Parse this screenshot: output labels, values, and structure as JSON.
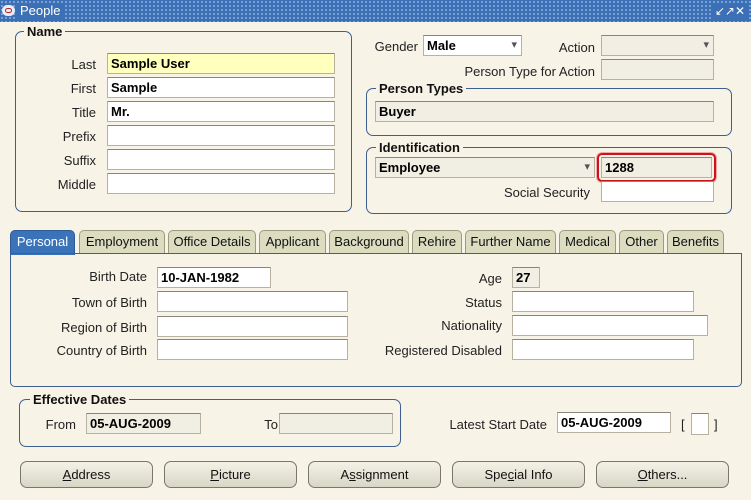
{
  "window": {
    "title": "People",
    "controls": "↙↗✕"
  },
  "name": {
    "legend": "Name",
    "last_label": "Last",
    "last_value": "Sample User",
    "first_label": "First",
    "first_value": "Sample",
    "title_label": "Title",
    "title_value": "Mr.",
    "prefix_label": "Prefix",
    "prefix_value": "",
    "suffix_label": "Suffix",
    "suffix_value": "",
    "middle_label": "Middle",
    "middle_value": ""
  },
  "header": {
    "gender_label": "Gender",
    "gender_value": "Male",
    "action_label": "Action",
    "action_value": "",
    "person_type_action_label": "Person Type for Action",
    "person_type_action_value": ""
  },
  "person_types": {
    "legend": "Person Types",
    "value": "Buyer"
  },
  "identification": {
    "legend": "Identification",
    "type_value": "Employee",
    "number_value": "1288",
    "ssn_label": "Social Security",
    "ssn_value": ""
  },
  "tabs": [
    {
      "label": "Personal",
      "active": true
    },
    {
      "label": "Employment"
    },
    {
      "label": "Office Details"
    },
    {
      "label": "Applicant"
    },
    {
      "label": "Background"
    },
    {
      "label": "Rehire"
    },
    {
      "label": "Further Name"
    },
    {
      "label": "Medical"
    },
    {
      "label": "Other"
    },
    {
      "label": "Benefits"
    }
  ],
  "personal": {
    "birth_date_label": "Birth Date",
    "birth_date_value": "10-JAN-1982",
    "town_label": "Town of Birth",
    "town_value": "",
    "region_label": "Region of Birth",
    "region_value": "",
    "country_label": "Country of Birth",
    "country_value": "",
    "age_label": "Age",
    "age_value": "27",
    "status_label": "Status",
    "status_value": "",
    "nationality_label": "Nationality",
    "nationality_value": "",
    "disabled_label": "Registered Disabled",
    "disabled_value": ""
  },
  "effective_dates": {
    "legend": "Effective Dates",
    "from_label": "From",
    "from_value": "05-AUG-2009",
    "to_label": "To",
    "to_value": ""
  },
  "latest_start": {
    "label": "Latest Start Date",
    "value": "05-AUG-2009",
    "bracket_open": "[",
    "bracket_close": "]"
  },
  "buttons": [
    {
      "pre": "",
      "key": "A",
      "post": "ddress"
    },
    {
      "pre": "",
      "key": "P",
      "post": "icture"
    },
    {
      "pre": "A",
      "key": "s",
      "post": "signment"
    },
    {
      "pre": "Spe",
      "key": "c",
      "post": "ial Info"
    },
    {
      "pre": "",
      "key": "O",
      "post": "thers..."
    }
  ]
}
